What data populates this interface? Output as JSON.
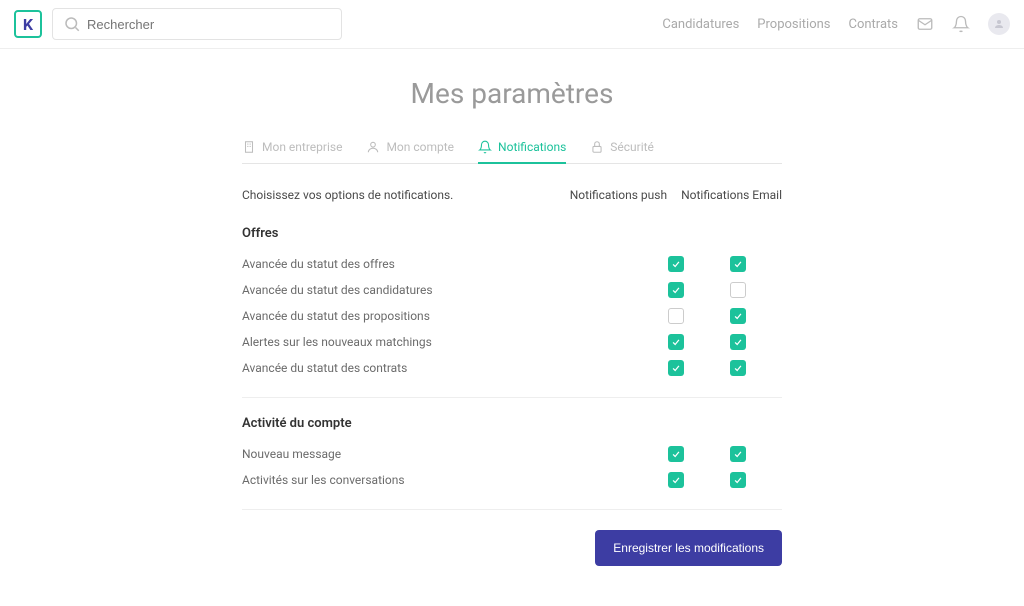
{
  "header": {
    "search_placeholder": "Rechercher",
    "nav": [
      "Candidatures",
      "Propositions",
      "Contrats"
    ]
  },
  "page": {
    "title": "Mes paramètres",
    "save_button": "Enregistrer les modifications"
  },
  "tabs": [
    {
      "label": "Mon entreprise",
      "icon": "building-icon",
      "active": false
    },
    {
      "label": "Mon compte",
      "icon": "user-icon",
      "active": false
    },
    {
      "label": "Notifications",
      "icon": "bell-icon",
      "active": true
    },
    {
      "label": "Sécurité",
      "icon": "lock-icon",
      "active": false
    }
  ],
  "intro": "Choisissez vos options de notifications.",
  "columns": {
    "push": "Notifications push",
    "email": "Notifications Email"
  },
  "sections": [
    {
      "title": "Offres",
      "rows": [
        {
          "label": "Avancée du statut des offres",
          "push": true,
          "email": true
        },
        {
          "label": "Avancée du statut des candidatures",
          "push": true,
          "email": false
        },
        {
          "label": "Avancée du statut des propositions",
          "push": false,
          "email": true
        },
        {
          "label": "Alertes sur les nouveaux matchings",
          "push": true,
          "email": true
        },
        {
          "label": "Avancée du statut des contrats",
          "push": true,
          "email": true
        }
      ]
    },
    {
      "title": "Activité du compte",
      "rows": [
        {
          "label": "Nouveau message",
          "push": true,
          "email": true
        },
        {
          "label": "Activités sur les conversations",
          "push": true,
          "email": true
        }
      ]
    }
  ]
}
